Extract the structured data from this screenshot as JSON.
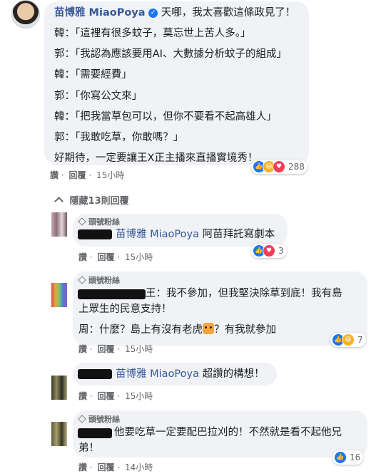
{
  "main_comment": {
    "author": "苗博雅 MiaoPoya",
    "lines": [
      "天哪，我太喜歡這條政見了！",
      "韓：「這裡有很多蚊子，莫忘世上苦人多。」",
      "郭：「我認為應該要用AI、大數據分析蚊子的組成」",
      "韓：「需要經費」",
      "郭：「你寫公文來」",
      "韓：「把我當草包可以，但你不要看不起高雄人」",
      "郭：「我敢吃草，你敢嗎？」",
      "好期待，一定要讓王X正主播來直播實境秀！"
    ],
    "actions": {
      "like": "讚",
      "reply": "回覆",
      "time": "15小時",
      "sep": "·"
    },
    "reaction_count": "288"
  },
  "hide_replies": "隱藏13則回覆",
  "replies": [
    {
      "badge": "頭號粉絲",
      "tag": "苗博雅 MiaoPoya",
      "text": "阿苗拜託寫劇本",
      "actions": {
        "like": "讚",
        "reply": "回覆",
        "time": "15小時",
        "sep": "·"
      },
      "reaction_count": "3"
    },
    {
      "badge": "頭號粉絲",
      "lines": [
        "王：我不參加，但我堅決除草到底！我有島",
        "上眾生的民意支持！",
        "周：什麼？島上有沒有老虎",
        "？有我就參加"
      ],
      "actions": {
        "like": "讚",
        "reply": "回覆",
        "time": "15小時",
        "sep": "·"
      },
      "reaction_count": "7"
    },
    {
      "tag": "苗博雅 MiaoPoya",
      "text": "超讚的構想！",
      "actions": {
        "like": "讚",
        "reply": "回覆",
        "time": "15小時",
        "sep": "·"
      }
    },
    {
      "badge": "頭號粉絲",
      "lines": [
        "他要吃草一定要配巴拉刈的！不然就是看不起他兄",
        "弟！"
      ],
      "actions": {
        "like": "讚",
        "reply": "回覆",
        "time": "14小時",
        "sep": "·"
      },
      "reaction_count": "16"
    }
  ],
  "icons": {
    "verified": "verified-badge-icon",
    "fan": "diamond-icon",
    "collapse": "chevron-up-icon",
    "tiger": "tiger-emoji-icon"
  },
  "colors": {
    "author": "#385898",
    "bubble": "#f0f2f5",
    "meta": "#65676b",
    "like": "#1877f2",
    "love": "#f33e58",
    "haha": "#f7b125"
  }
}
